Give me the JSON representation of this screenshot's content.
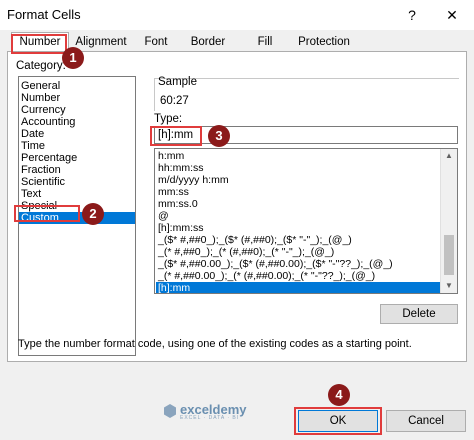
{
  "window": {
    "title": "Format Cells",
    "help": "?",
    "close": "✕"
  },
  "tabs": [
    "Number",
    "Alignment",
    "Font",
    "Border",
    "Fill",
    "Protection"
  ],
  "category": {
    "label": "Category:",
    "items": [
      "General",
      "Number",
      "Currency",
      "Accounting",
      "Date",
      "Time",
      "Percentage",
      "Fraction",
      "Scientific",
      "Text",
      "Special",
      "Custom"
    ],
    "selected": "Custom"
  },
  "sample": {
    "label": "Sample",
    "value": "60:27"
  },
  "type": {
    "label": "Type:",
    "value": "[h]:mm",
    "options": [
      "h:mm",
      "hh:mm:ss",
      "m/d/yyyy h:mm",
      "mm:ss",
      "mm:ss.0",
      "@",
      "[h]:mm:ss",
      "_($* #,##0_);_($* (#,##0);_($* \"-\"_);_(@_)",
      "_(* #,##0_);_(* (#,##0);_(* \"-\"_);_(@_)",
      "_($* #,##0.00_);_($* (#,##0.00);_($* \"-\"??_);_(@_)",
      "_(* #,##0.00_);_(* (#,##0.00);_(* \"-\"??_);_(@_)",
      "[h]:mm"
    ],
    "selected": "[h]:mm"
  },
  "buttons": {
    "delete": "Delete",
    "ok": "OK",
    "cancel": "Cancel"
  },
  "hint": "Type the number format code, using one of the existing codes as a starting point.",
  "badges": [
    "1",
    "2",
    "3",
    "4"
  ],
  "watermark": {
    "name": "exceldemy",
    "tagline": "EXCEL · DATA · BI"
  },
  "colors": {
    "selection": "#0078d7",
    "highlight_box": "#e03c3c",
    "badge": "#8b1a1a"
  }
}
